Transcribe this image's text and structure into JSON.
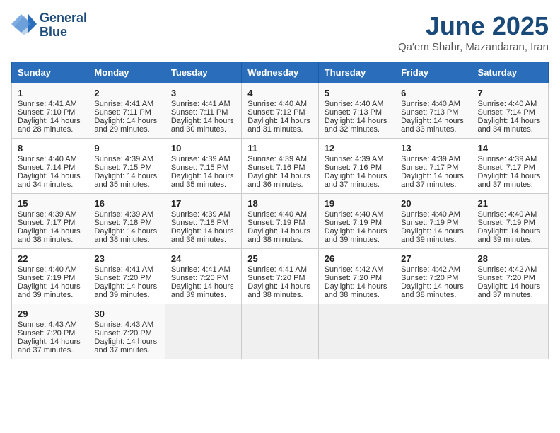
{
  "header": {
    "logo_line1": "General",
    "logo_line2": "Blue",
    "title": "June 2025",
    "subtitle": "Qa'em Shahr, Mazandaran, Iran"
  },
  "calendar": {
    "days_of_week": [
      "Sunday",
      "Monday",
      "Tuesday",
      "Wednesday",
      "Thursday",
      "Friday",
      "Saturday"
    ],
    "weeks": [
      [
        {
          "day": "",
          "sunrise": "",
          "sunset": "",
          "daylight": "",
          "empty": true
        },
        {
          "day": "2",
          "sunrise": "Sunrise: 4:41 AM",
          "sunset": "Sunset: 7:11 PM",
          "daylight": "Daylight: 14 hours and 29 minutes."
        },
        {
          "day": "3",
          "sunrise": "Sunrise: 4:41 AM",
          "sunset": "Sunset: 7:11 PM",
          "daylight": "Daylight: 14 hours and 30 minutes."
        },
        {
          "day": "4",
          "sunrise": "Sunrise: 4:40 AM",
          "sunset": "Sunset: 7:12 PM",
          "daylight": "Daylight: 14 hours and 31 minutes."
        },
        {
          "day": "5",
          "sunrise": "Sunrise: 4:40 AM",
          "sunset": "Sunset: 7:13 PM",
          "daylight": "Daylight: 14 hours and 32 minutes."
        },
        {
          "day": "6",
          "sunrise": "Sunrise: 4:40 AM",
          "sunset": "Sunset: 7:13 PM",
          "daylight": "Daylight: 14 hours and 33 minutes."
        },
        {
          "day": "7",
          "sunrise": "Sunrise: 4:40 AM",
          "sunset": "Sunset: 7:14 PM",
          "daylight": "Daylight: 14 hours and 34 minutes."
        }
      ],
      [
        {
          "day": "8",
          "sunrise": "Sunrise: 4:40 AM",
          "sunset": "Sunset: 7:14 PM",
          "daylight": "Daylight: 14 hours and 34 minutes."
        },
        {
          "day": "9",
          "sunrise": "Sunrise: 4:39 AM",
          "sunset": "Sunset: 7:15 PM",
          "daylight": "Daylight: 14 hours and 35 minutes."
        },
        {
          "day": "10",
          "sunrise": "Sunrise: 4:39 AM",
          "sunset": "Sunset: 7:15 PM",
          "daylight": "Daylight: 14 hours and 35 minutes."
        },
        {
          "day": "11",
          "sunrise": "Sunrise: 4:39 AM",
          "sunset": "Sunset: 7:16 PM",
          "daylight": "Daylight: 14 hours and 36 minutes."
        },
        {
          "day": "12",
          "sunrise": "Sunrise: 4:39 AM",
          "sunset": "Sunset: 7:16 PM",
          "daylight": "Daylight: 14 hours and 37 minutes."
        },
        {
          "day": "13",
          "sunrise": "Sunrise: 4:39 AM",
          "sunset": "Sunset: 7:17 PM",
          "daylight": "Daylight: 14 hours and 37 minutes."
        },
        {
          "day": "14",
          "sunrise": "Sunrise: 4:39 AM",
          "sunset": "Sunset: 7:17 PM",
          "daylight": "Daylight: 14 hours and 37 minutes."
        }
      ],
      [
        {
          "day": "15",
          "sunrise": "Sunrise: 4:39 AM",
          "sunset": "Sunset: 7:17 PM",
          "daylight": "Daylight: 14 hours and 38 minutes."
        },
        {
          "day": "16",
          "sunrise": "Sunrise: 4:39 AM",
          "sunset": "Sunset: 7:18 PM",
          "daylight": "Daylight: 14 hours and 38 minutes."
        },
        {
          "day": "17",
          "sunrise": "Sunrise: 4:39 AM",
          "sunset": "Sunset: 7:18 PM",
          "daylight": "Daylight: 14 hours and 38 minutes."
        },
        {
          "day": "18",
          "sunrise": "Sunrise: 4:40 AM",
          "sunset": "Sunset: 7:19 PM",
          "daylight": "Daylight: 14 hours and 38 minutes."
        },
        {
          "day": "19",
          "sunrise": "Sunrise: 4:40 AM",
          "sunset": "Sunset: 7:19 PM",
          "daylight": "Daylight: 14 hours and 39 minutes."
        },
        {
          "day": "20",
          "sunrise": "Sunrise: 4:40 AM",
          "sunset": "Sunset: 7:19 PM",
          "daylight": "Daylight: 14 hours and 39 minutes."
        },
        {
          "day": "21",
          "sunrise": "Sunrise: 4:40 AM",
          "sunset": "Sunset: 7:19 PM",
          "daylight": "Daylight: 14 hours and 39 minutes."
        }
      ],
      [
        {
          "day": "22",
          "sunrise": "Sunrise: 4:40 AM",
          "sunset": "Sunset: 7:19 PM",
          "daylight": "Daylight: 14 hours and 39 minutes."
        },
        {
          "day": "23",
          "sunrise": "Sunrise: 4:41 AM",
          "sunset": "Sunset: 7:20 PM",
          "daylight": "Daylight: 14 hours and 39 minutes."
        },
        {
          "day": "24",
          "sunrise": "Sunrise: 4:41 AM",
          "sunset": "Sunset: 7:20 PM",
          "daylight": "Daylight: 14 hours and 39 minutes."
        },
        {
          "day": "25",
          "sunrise": "Sunrise: 4:41 AM",
          "sunset": "Sunset: 7:20 PM",
          "daylight": "Daylight: 14 hours and 38 minutes."
        },
        {
          "day": "26",
          "sunrise": "Sunrise: 4:42 AM",
          "sunset": "Sunset: 7:20 PM",
          "daylight": "Daylight: 14 hours and 38 minutes."
        },
        {
          "day": "27",
          "sunrise": "Sunrise: 4:42 AM",
          "sunset": "Sunset: 7:20 PM",
          "daylight": "Daylight: 14 hours and 38 minutes."
        },
        {
          "day": "28",
          "sunrise": "Sunrise: 4:42 AM",
          "sunset": "Sunset: 7:20 PM",
          "daylight": "Daylight: 14 hours and 37 minutes."
        }
      ],
      [
        {
          "day": "29",
          "sunrise": "Sunrise: 4:43 AM",
          "sunset": "Sunset: 7:20 PM",
          "daylight": "Daylight: 14 hours and 37 minutes."
        },
        {
          "day": "30",
          "sunrise": "Sunrise: 4:43 AM",
          "sunset": "Sunset: 7:20 PM",
          "daylight": "Daylight: 14 hours and 37 minutes."
        },
        {
          "day": "",
          "sunrise": "",
          "sunset": "",
          "daylight": "",
          "empty": true
        },
        {
          "day": "",
          "sunrise": "",
          "sunset": "",
          "daylight": "",
          "empty": true
        },
        {
          "day": "",
          "sunrise": "",
          "sunset": "",
          "daylight": "",
          "empty": true
        },
        {
          "day": "",
          "sunrise": "",
          "sunset": "",
          "daylight": "",
          "empty": true
        },
        {
          "day": "",
          "sunrise": "",
          "sunset": "",
          "daylight": "",
          "empty": true
        }
      ]
    ]
  },
  "first_day": {
    "day": "1",
    "sunrise": "Sunrise: 4:41 AM",
    "sunset": "Sunset: 7:10 PM",
    "daylight": "Daylight: 14 hours and 28 minutes."
  }
}
